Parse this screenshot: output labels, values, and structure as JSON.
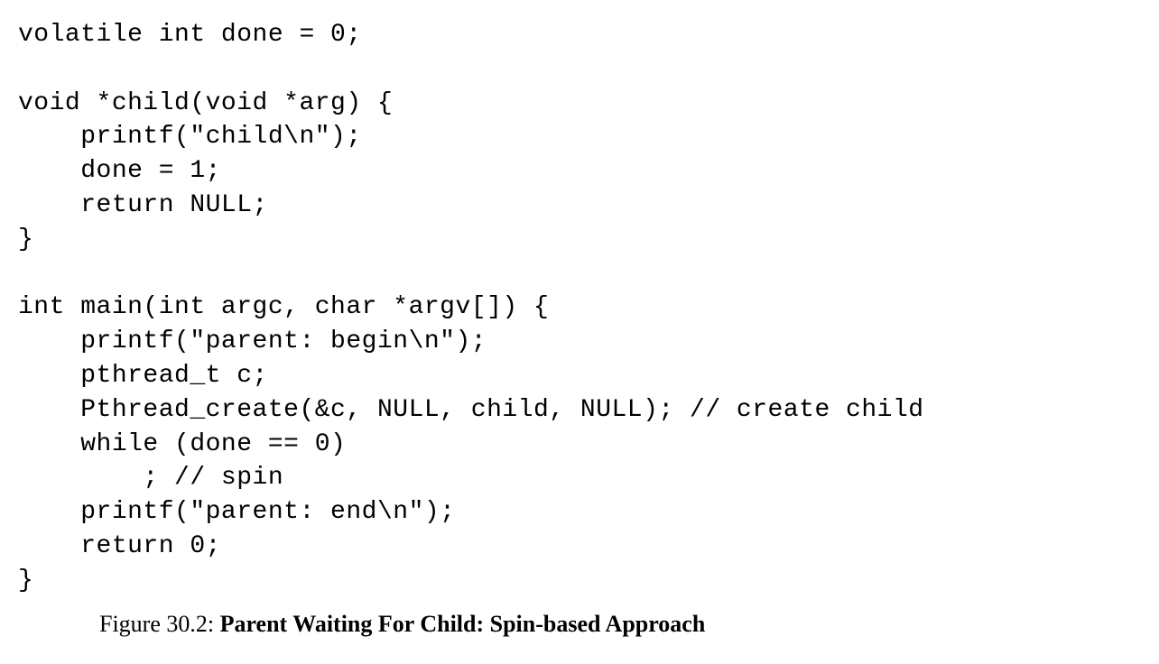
{
  "code": {
    "line1": "volatile int done = 0;",
    "line2": "",
    "line3": "void *child(void *arg) {",
    "line4": "    printf(\"child\\n\");",
    "line5": "    done = 1;",
    "line6": "    return NULL;",
    "line7": "}",
    "line8": "",
    "line9": "int main(int argc, char *argv[]) {",
    "line10": "    printf(\"parent: begin\\n\");",
    "line11": "    pthread_t c;",
    "line12": "    Pthread_create(&c, NULL, child, NULL); // create child",
    "line13": "    while (done == 0)",
    "line14": "        ; // spin",
    "line15": "    printf(\"parent: end\\n\");",
    "line16": "    return 0;",
    "line17": "}"
  },
  "figure": {
    "label": "Figure 30.2: ",
    "title": "Parent Waiting For Child: Spin-based Approach"
  }
}
